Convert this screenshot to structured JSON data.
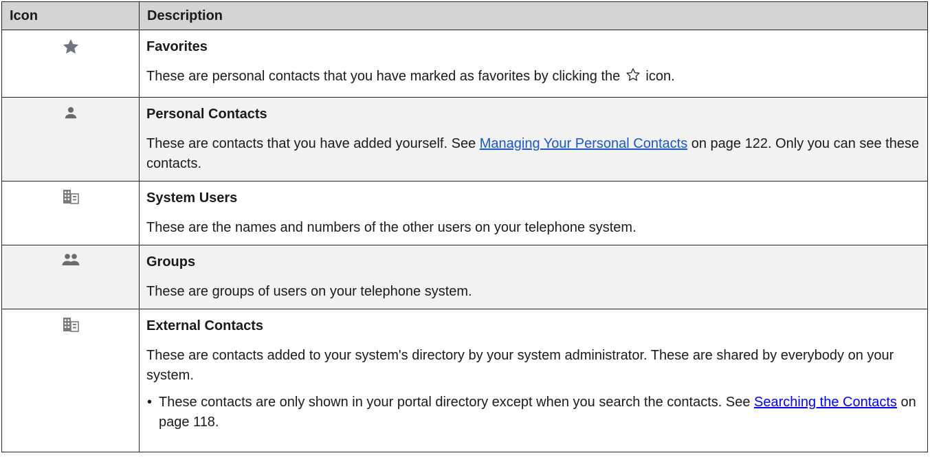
{
  "header": {
    "col_icon": "Icon",
    "col_description": "Description"
  },
  "rows": [
    {
      "icon": "star-icon",
      "title": "Favorites",
      "text_before": "These are personal contacts that you have marked as favorites by clicking the",
      "inline_icon": "star-outline-icon",
      "text_after": "icon."
    },
    {
      "icon": "person-icon",
      "title": "Personal Contacts",
      "text_before": "These are contacts that you have added yourself. See",
      "link": "Managing Your Personal Contacts",
      "text_after": "on page 122. Only you can see these contacts."
    },
    {
      "icon": "building-icon",
      "title": "System Users",
      "text": "These are the names and numbers of the other users on your telephone system."
    },
    {
      "icon": "group-icon",
      "title": "Groups",
      "text": "These are groups of users on your telephone system."
    },
    {
      "icon": "building-icon",
      "title": "External Contacts",
      "text": "These are contacts added to your system's directory by your system administrator. These are shared by everybody on your system.",
      "bullet": {
        "marker": "•",
        "text_before": "These contacts are only shown in your portal directory except when you search the contacts. See",
        "link": "Searching the Contacts",
        "text_after": "on page 118."
      }
    }
  ],
  "colors": {
    "header_bg": "#d4d4d4",
    "shaded_row_bg": "#f2f2f2",
    "link": "#1a56c4",
    "icon": "#6b6b6b"
  }
}
